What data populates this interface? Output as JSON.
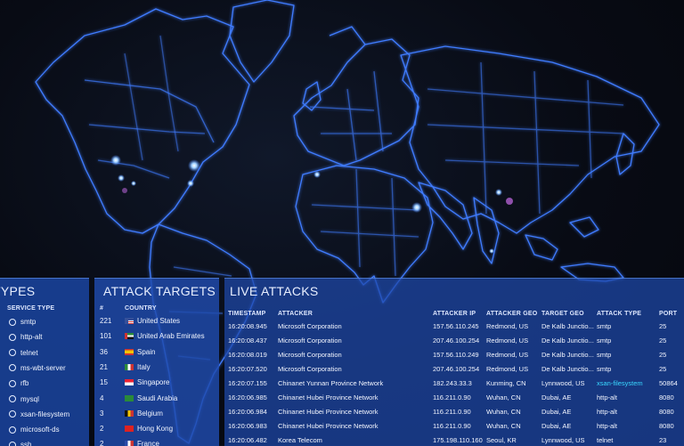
{
  "service_types": {
    "title": "TYPES",
    "column": "SERVICE TYPE",
    "items": [
      "smtp",
      "http-alt",
      "telnet",
      "ms-wbt-server",
      "rfb",
      "mysql",
      "xsan-filesystem",
      "microsoft-ds",
      "ssh"
    ]
  },
  "attack_targets": {
    "title": "ATTACK TARGETS",
    "col_num": "#",
    "col_country": "COUNTRY",
    "rows": [
      {
        "count": "221",
        "country": "United States",
        "flag": "flag-us-icon"
      },
      {
        "count": "101",
        "country": "United Arab Emirates",
        "flag": "flag-ae-icon"
      },
      {
        "count": "36",
        "country": "Spain",
        "flag": "flag-es-icon"
      },
      {
        "count": "21",
        "country": "Italy",
        "flag": "flag-it-icon"
      },
      {
        "count": "15",
        "country": "Singapore",
        "flag": "flag-sg-icon"
      },
      {
        "count": "4",
        "country": "Saudi Arabia",
        "flag": "flag-sa-icon"
      },
      {
        "count": "3",
        "country": "Belgium",
        "flag": "flag-be-icon"
      },
      {
        "count": "2",
        "country": "Hong Kong",
        "flag": "flag-hk-icon"
      },
      {
        "count": "2",
        "country": "France",
        "flag": "flag-fr-icon"
      }
    ]
  },
  "live_attacks": {
    "title": "LIVE ATTACKS",
    "headers": [
      "TIMESTAMP",
      "ATTACKER",
      "ATTACKER IP",
      "ATTACKER GEO",
      "TARGET GEO",
      "ATTACK TYPE",
      "PORT"
    ],
    "rows": [
      {
        "time": "16:20:08.945",
        "attacker": "Microsoft Corporation",
        "ip": "157.56.110.245",
        "geo": "Redmond, US",
        "tgeo": "De Kalb Junctio...",
        "type": "smtp",
        "port": "25"
      },
      {
        "time": "16:20:08.437",
        "attacker": "Microsoft Corporation",
        "ip": "207.46.100.254",
        "geo": "Redmond, US",
        "tgeo": "De Kalb Junctio...",
        "type": "smtp",
        "port": "25"
      },
      {
        "time": "16:20:08.019",
        "attacker": "Microsoft Corporation",
        "ip": "157.56.110.249",
        "geo": "Redmond, US",
        "tgeo": "De Kalb Junctio...",
        "type": "smtp",
        "port": "25"
      },
      {
        "time": "16:20:07.520",
        "attacker": "Microsoft Corporation",
        "ip": "207.46.100.254",
        "geo": "Redmond, US",
        "tgeo": "De Kalb Junctio...",
        "type": "smtp",
        "port": "25"
      },
      {
        "time": "16:20:07.155",
        "attacker": "Chinanet Yunnan Province Network",
        "ip": "182.243.33.3",
        "geo": "Kunming, CN",
        "tgeo": "Lynnwood, US",
        "type": "xsan-filesystem",
        "port": "50864",
        "highlight": true
      },
      {
        "time": "16:20:06.985",
        "attacker": "Chinanet Hubei Province Network",
        "ip": "116.211.0.90",
        "geo": "Wuhan, CN",
        "tgeo": "Dubai, AE",
        "type": "http-alt",
        "port": "8080"
      },
      {
        "time": "16:20:06.984",
        "attacker": "Chinanet Hubei Province Network",
        "ip": "116.211.0.90",
        "geo": "Wuhan, CN",
        "tgeo": "Dubai, AE",
        "type": "http-alt",
        "port": "8080"
      },
      {
        "time": "16:20:06.983",
        "attacker": "Chinanet Hubei Province Network",
        "ip": "116.211.0.90",
        "geo": "Wuhan, CN",
        "tgeo": "Dubai, AE",
        "type": "http-alt",
        "port": "8080"
      },
      {
        "time": "16:20:06.482",
        "attacker": "Korea Telecom",
        "ip": "175.198.110.160",
        "geo": "Seoul, KR",
        "tgeo": "Lynnwood, US",
        "type": "telnet",
        "port": "23"
      }
    ]
  },
  "colors": {
    "map_line": "#3f7cff",
    "panel": "#1c48aa",
    "highlight": "#39d8ff"
  }
}
